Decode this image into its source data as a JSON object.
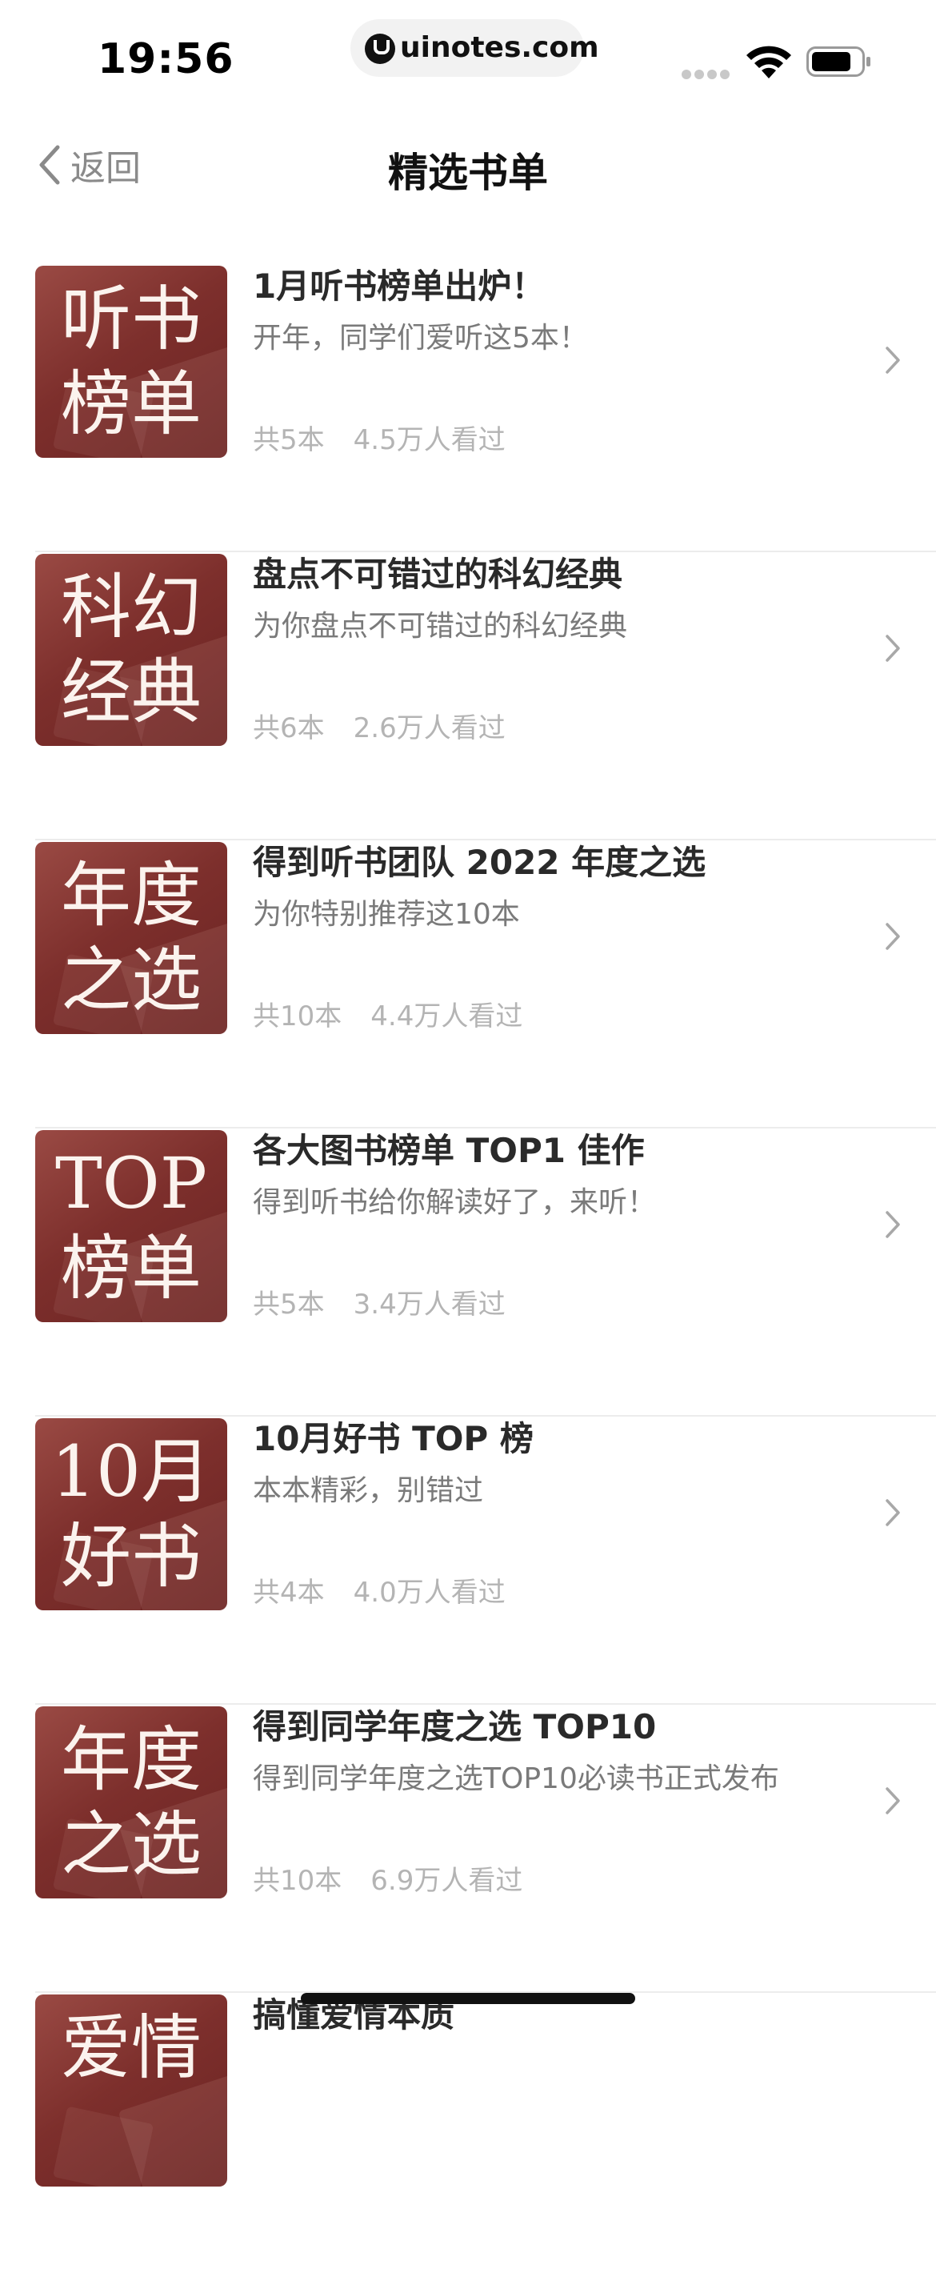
{
  "status_bar": {
    "time": "19:56",
    "url": "uinotes.com"
  },
  "nav": {
    "back_label": "返回",
    "title": "精选书单"
  },
  "items": [
    {
      "cover_line1": "听书",
      "cover_line2": "榜单",
      "title": "1月听书榜单出炉！",
      "subtitle": "开年，同学们爱听这5本！",
      "count": "共5本",
      "views": "4.5万人看过"
    },
    {
      "cover_line1": "科幻",
      "cover_line2": "经典",
      "title": "盘点不可错过的科幻经典",
      "subtitle": "为你盘点不可错过的科幻经典",
      "count": "共6本",
      "views": "2.6万人看过"
    },
    {
      "cover_line1": "年度",
      "cover_line2": "之选",
      "title": "得到听书团队 2022 年度之选",
      "subtitle": "为你特别推荐这10本",
      "count": "共10本",
      "views": "4.4万人看过"
    },
    {
      "cover_line1": "TOP",
      "cover_line2": "榜单",
      "title": "各大图书榜单 TOP1 佳作",
      "subtitle": "得到听书给你解读好了，来听！",
      "count": "共5本",
      "views": "3.4万人看过"
    },
    {
      "cover_line1": "10月",
      "cover_line2": "好书",
      "title": "10月好书 TOP 榜",
      "subtitle": "本本精彩，别错过",
      "count": "共4本",
      "views": "4.0万人看过"
    },
    {
      "cover_line1": "年度",
      "cover_line2": "之选",
      "title": "得到同学年度之选 TOP10",
      "subtitle": "得到同学年度之选TOP10必读书正式发布",
      "count": "共10本",
      "views": "6.9万人看过"
    },
    {
      "cover_line1": "爱情",
      "cover_line2": "",
      "title": "搞懂爱情本质",
      "subtitle": "",
      "count": "",
      "views": ""
    }
  ],
  "icons": {
    "back": "chevron-left-icon",
    "row_arrow": "chevron-right-icon",
    "wifi": "wifi-icon",
    "battery": "battery-icon"
  },
  "colors": {
    "cover_bg": "#7d2f2c",
    "title": "#2a2a2a",
    "subtitle": "#7a7a7a",
    "meta": "#b4b4b4"
  }
}
